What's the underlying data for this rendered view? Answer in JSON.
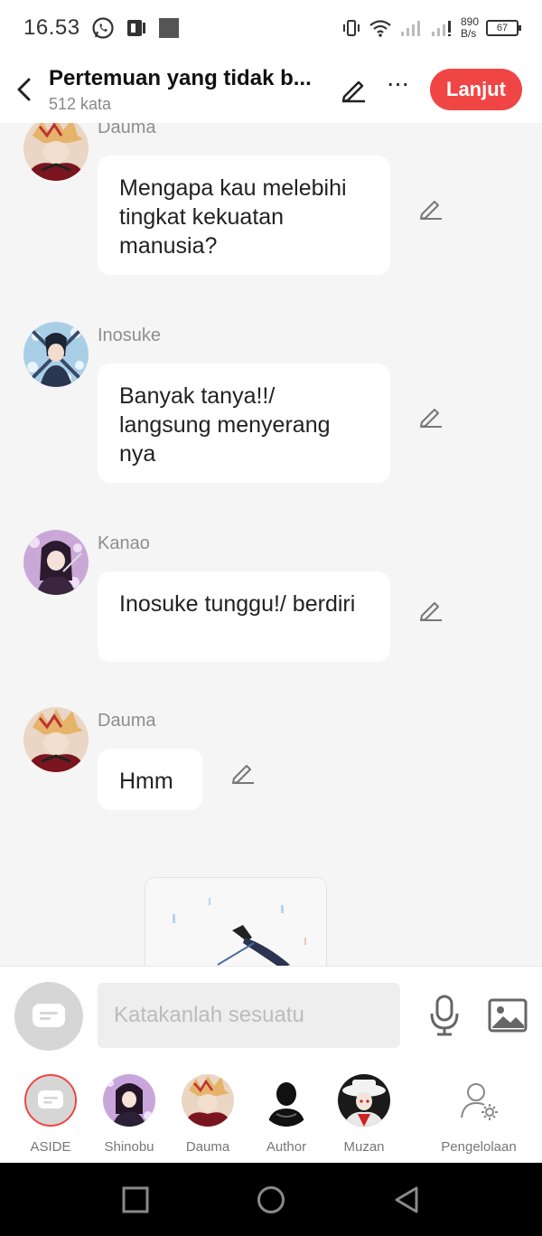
{
  "status_bar": {
    "time": "16.53",
    "net_speed_value": "890",
    "net_speed_unit": "B/s",
    "battery": "67"
  },
  "header": {
    "title": "Pertemuan yang tidak b...",
    "word_count": "512 kata",
    "next_label": "Lanjut"
  },
  "messages": [
    {
      "sender": "Dauma",
      "text": "Mengapa kau melebihi tingkat kekuatan manusia?"
    },
    {
      "sender": "Inosuke",
      "text": "Banyak tanya!!/ langsung menyerang nya"
    },
    {
      "sender": "Kanao",
      "text": "Inosuke tunggu!/ berdiri"
    },
    {
      "sender": "Dauma",
      "text": "Hmm"
    }
  ],
  "input": {
    "placeholder": "Katakanlah sesuatu"
  },
  "characters": [
    {
      "label": "ASIDE"
    },
    {
      "label": "Shinobu"
    },
    {
      "label": "Dauma"
    },
    {
      "label": "Author"
    },
    {
      "label": "Muzan"
    },
    {
      "label": "Pengelolaan"
    }
  ],
  "colors": {
    "accent": "#f04545",
    "background": "#f5f5f5",
    "bubble": "#ffffff"
  },
  "icons": [
    "back-icon",
    "pencil-icon",
    "more-icon",
    "mic-icon",
    "image-icon",
    "aside-icon",
    "manage-icon",
    "recent-apps-icon",
    "home-icon",
    "back-nav-icon"
  ]
}
